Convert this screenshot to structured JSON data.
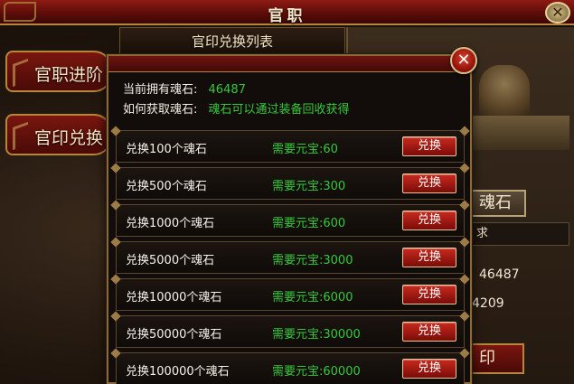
{
  "window": {
    "title": "官职",
    "close_icon": "close-icon"
  },
  "side_tabs": [
    {
      "label": "官职进阶"
    },
    {
      "label": "官印兑换"
    }
  ],
  "list_title": "官印兑换列表",
  "background_panel": {
    "button_label": "魂石",
    "field_text": "求",
    "number1": "46487",
    "number2": "4209",
    "bottom_button_label": "印"
  },
  "dialog": {
    "close_icon": "close-icon",
    "current_label": "当前拥有魂石:",
    "current_value": "46487",
    "howto_label": "如何获取魂石:",
    "howto_value": "魂石可以通过装备回收获得",
    "exchange_rows": [
      {
        "name": "兑换100个魂石",
        "cost": "需要元宝:60",
        "button": "兑换"
      },
      {
        "name": "兑换500个魂石",
        "cost": "需要元宝:300",
        "button": "兑换"
      },
      {
        "name": "兑换1000个魂石",
        "cost": "需要元宝:600",
        "button": "兑换"
      },
      {
        "name": "兑换5000个魂石",
        "cost": "需要元宝:3000",
        "button": "兑换"
      },
      {
        "name": "兑换10000个魂石",
        "cost": "需要元宝:6000",
        "button": "兑换"
      },
      {
        "name": "兑换50000个魂石",
        "cost": "需要元宝:30000",
        "button": "兑换"
      },
      {
        "name": "兑换100000个魂石",
        "cost": "需要元宝:60000",
        "button": "兑换"
      }
    ]
  },
  "colors": {
    "accent_green": "#35c93a",
    "button_red": "#c82a1e",
    "frame_gold": "#b8863a"
  }
}
